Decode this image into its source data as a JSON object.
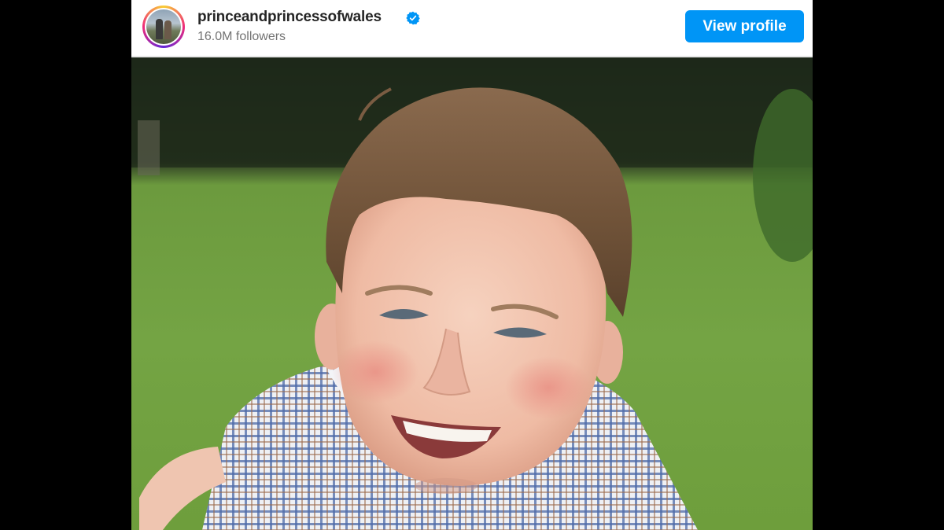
{
  "post_header": {
    "username": "princeandprincessofwales",
    "followers": "16.0M followers",
    "view_profile_label": "View profile",
    "verified": true
  },
  "colors": {
    "page_background": "#000000",
    "button_blue": "#0095f6",
    "verified_blue": "#0095f6",
    "username_text": "#262626",
    "secondary_text": "#737373"
  },
  "photo": {
    "subject": "smiling child in checked shirt lying on grass"
  }
}
